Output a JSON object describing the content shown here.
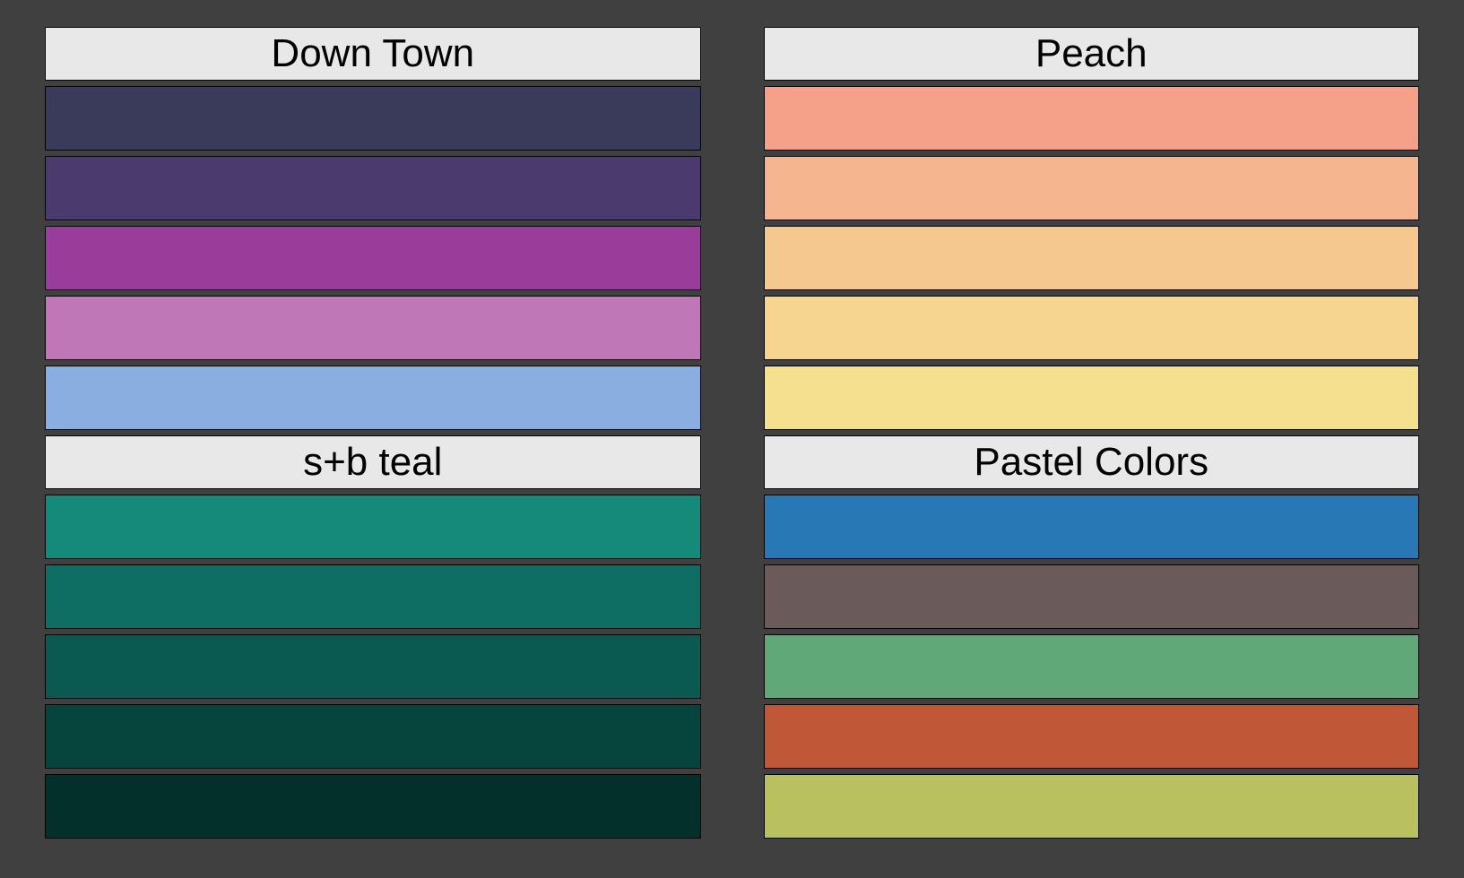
{
  "palettes": {
    "left": [
      {
        "title": "Down Town",
        "colors": [
          "#3a3a5a",
          "#4a3a6e",
          "#9a3d9a",
          "#c077b8",
          "#8aaee0"
        ]
      },
      {
        "title": "s+b teal",
        "colors": [
          "#158a7a",
          "#0e6e63",
          "#0a5a52",
          "#06443e",
          "#03302b"
        ]
      }
    ],
    "right": [
      {
        "title": "Peach",
        "colors": [
          "#f5a088",
          "#f5b58f",
          "#f5c890",
          "#f5d590",
          "#f5e090"
        ]
      },
      {
        "title": "Pastel Colors",
        "colors": [
          "#2878b5",
          "#6a5a5a",
          "#60a878",
          "#c05838",
          "#b8c060"
        ]
      }
    ]
  }
}
